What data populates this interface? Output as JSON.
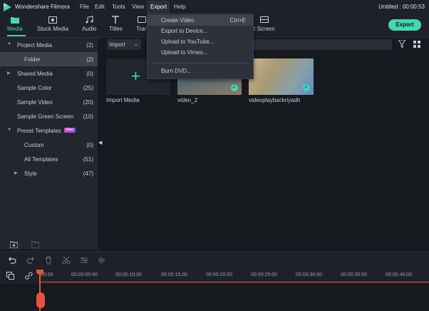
{
  "app": {
    "title": "Wondershare Filmora",
    "project_title": "Untitled : 00:00:53"
  },
  "menubar": {
    "file": "File",
    "edit": "Edit",
    "tools": "Tools",
    "view": "View",
    "export": "Export",
    "help": "Help"
  },
  "toolbar": {
    "media": "Media",
    "stock_media": "Stock Media",
    "audio": "Audio",
    "titles": "Titles",
    "transitions": "Tran",
    "split_screen": "t Screen",
    "export_button": "Export"
  },
  "export_menu": {
    "create_video": "Create Video",
    "create_video_shortcut": "Ctrl+E",
    "export_to_device": "Export to Device...",
    "upload_youtube": "Upload to YouTube...",
    "upload_vimeo": "Upload to Vimeo...",
    "burn_dvd": "Burn DVD..."
  },
  "sidebar": {
    "project_media": {
      "label": "Project Media",
      "count": "(2)"
    },
    "folder": {
      "label": "Folder",
      "count": "(2)"
    },
    "shared_media": {
      "label": "Shared Media",
      "count": "(0)"
    },
    "sample_color": {
      "label": "Sample Color",
      "count": "(25)"
    },
    "sample_video": {
      "label": "Sample Video",
      "count": "(20)"
    },
    "sample_green_screen": {
      "label": "Sample Green Screen",
      "count": "(10)"
    },
    "preset_templates": {
      "label": "Preset Templates",
      "badge": "New"
    },
    "custom": {
      "label": "Custom",
      "count": "(0)"
    },
    "all_templates": {
      "label": "All Templates",
      "count": "(51)"
    },
    "style": {
      "label": "Style",
      "count": "(47)"
    }
  },
  "media": {
    "import_button": "Import",
    "import_media_label": "Import Media",
    "clips": [
      {
        "name": "video_2"
      },
      {
        "name": "videoplaybackriyadh"
      }
    ]
  },
  "timeline": {
    "ticks": [
      "00:00",
      "00:00:05:00",
      "00:00:10:00",
      "00:00:15:00",
      "00:00:20:00",
      "00:00:25:00",
      "00:00:30:00",
      "00:00:35:00",
      "00:00:40:00"
    ]
  },
  "colors": {
    "accent": "#3fd7b4",
    "playhead": "#e8533f"
  }
}
